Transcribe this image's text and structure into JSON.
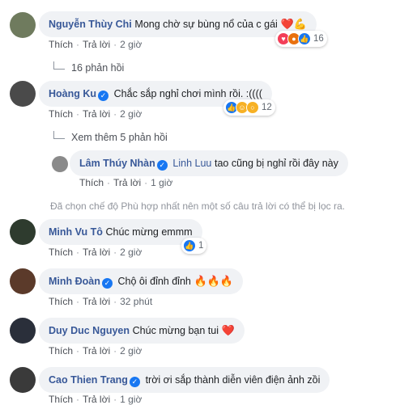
{
  "comments": [
    {
      "name": "Nguyễn Thùy Chi",
      "verified": false,
      "text": "Mong chờ sự bùng nổ của c gái",
      "emojis": "❤️💪",
      "reply_label": "Trả lời",
      "like_label": "Thích",
      "time": "2 giờ",
      "reaction_count": "16",
      "avatar_color": "#6f7b5e"
    },
    {
      "name": "Hoàng Ku",
      "verified": true,
      "text": "Chắc sắp nghỉ chơi mình rồi. :((((",
      "emojis": "",
      "reply_label": "Trả lời",
      "like_label": "Thích",
      "time": "2 giờ",
      "reaction_count": "12",
      "avatar_color": "#4a4a4a"
    },
    {
      "name": "Minh Vu Tô",
      "verified": false,
      "text": "Chúc mừng emmm",
      "emojis": "",
      "reply_label": "Trả lời",
      "like_label": "Thích",
      "time": "2 giờ",
      "reaction_count": "1",
      "avatar_color": "#2e3b2e"
    },
    {
      "name": "Minh Đoàn",
      "verified": true,
      "text": "Chộ ôi đỉnh đỉnh",
      "emojis": "🔥🔥🔥",
      "reply_label": "Trả lời",
      "like_label": "Thích",
      "time": "32 phút",
      "reaction_count": "",
      "avatar_color": "#5b3a2a"
    },
    {
      "name": "Duy Duc Nguyen",
      "verified": false,
      "text": "Chúc mừng bạn tui",
      "emojis": "❤️",
      "reply_label": "Trả lời",
      "like_label": "Thích",
      "time": "2 giờ",
      "reaction_count": "",
      "avatar_color": "#2a2f3a"
    },
    {
      "name": "Cao Thien Trang",
      "verified": true,
      "text": "trời ơi sắp thành diễn viên điện ảnh zồi",
      "emojis": "",
      "reply_label": "Trả lời",
      "like_label": "Thích",
      "time": "1 giờ",
      "reaction_count": "",
      "avatar_color": "#3a3a3a"
    }
  ],
  "replies_1": "16 phản hồi",
  "replies_2": "Xem thêm 5 phản hồi",
  "nested_reply": {
    "name": "Lâm Thúy Nhàn",
    "verified": true,
    "mention": "Linh Luu",
    "text": "tao cũng bị nghỉ rồi đây này",
    "like_label": "Thích",
    "reply_label": "Trả lời",
    "time": "1 giờ",
    "avatar_color": "#8a8a8a"
  },
  "filter_notice": "Đã chọn chế độ Phù hợp nhất nên một số câu trả lời có thể bị lọc ra.",
  "colors": {
    "name": "#385898",
    "bubble": "#f0f2f5",
    "like_blue": "#1877f2",
    "love_red": "#f33e58",
    "haha_yellow": "#f7b125"
  }
}
